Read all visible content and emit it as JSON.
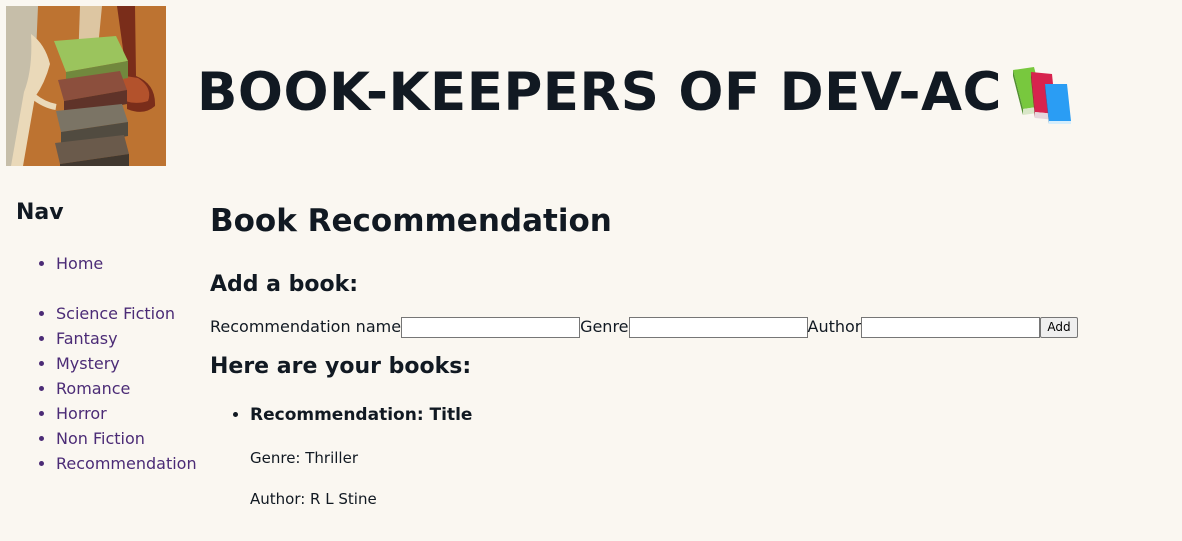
{
  "header": {
    "title": "BOOK-KEEPERS OF DEV-AC",
    "title_icon": "books-icon",
    "image": "stacked-books-illustration"
  },
  "nav": {
    "title": "Nav",
    "primary_items": [
      {
        "label": "Home"
      }
    ],
    "genre_items": [
      {
        "label": "Science Fiction"
      },
      {
        "label": "Fantasy"
      },
      {
        "label": "Mystery"
      },
      {
        "label": "Romance"
      },
      {
        "label": "Horror"
      },
      {
        "label": "Non Fiction"
      },
      {
        "label": "Recommendation"
      }
    ]
  },
  "main": {
    "title": "Book Recommendation",
    "add_section_title": "Add a book:",
    "form": {
      "name_label": "Recommendation name",
      "name_value": "",
      "genre_label": "Genre",
      "genre_value": "",
      "author_label": "Author",
      "author_value": "",
      "add_button": "Add"
    },
    "books_section_title": "Here are your books:",
    "books": [
      {
        "name": "Recommendation: Title",
        "genre": "Genre: Thriller",
        "author": "Author: R L Stine"
      }
    ]
  },
  "colors": {
    "background": "#faf7f1",
    "text": "#111922",
    "link": "#4b2b76"
  }
}
